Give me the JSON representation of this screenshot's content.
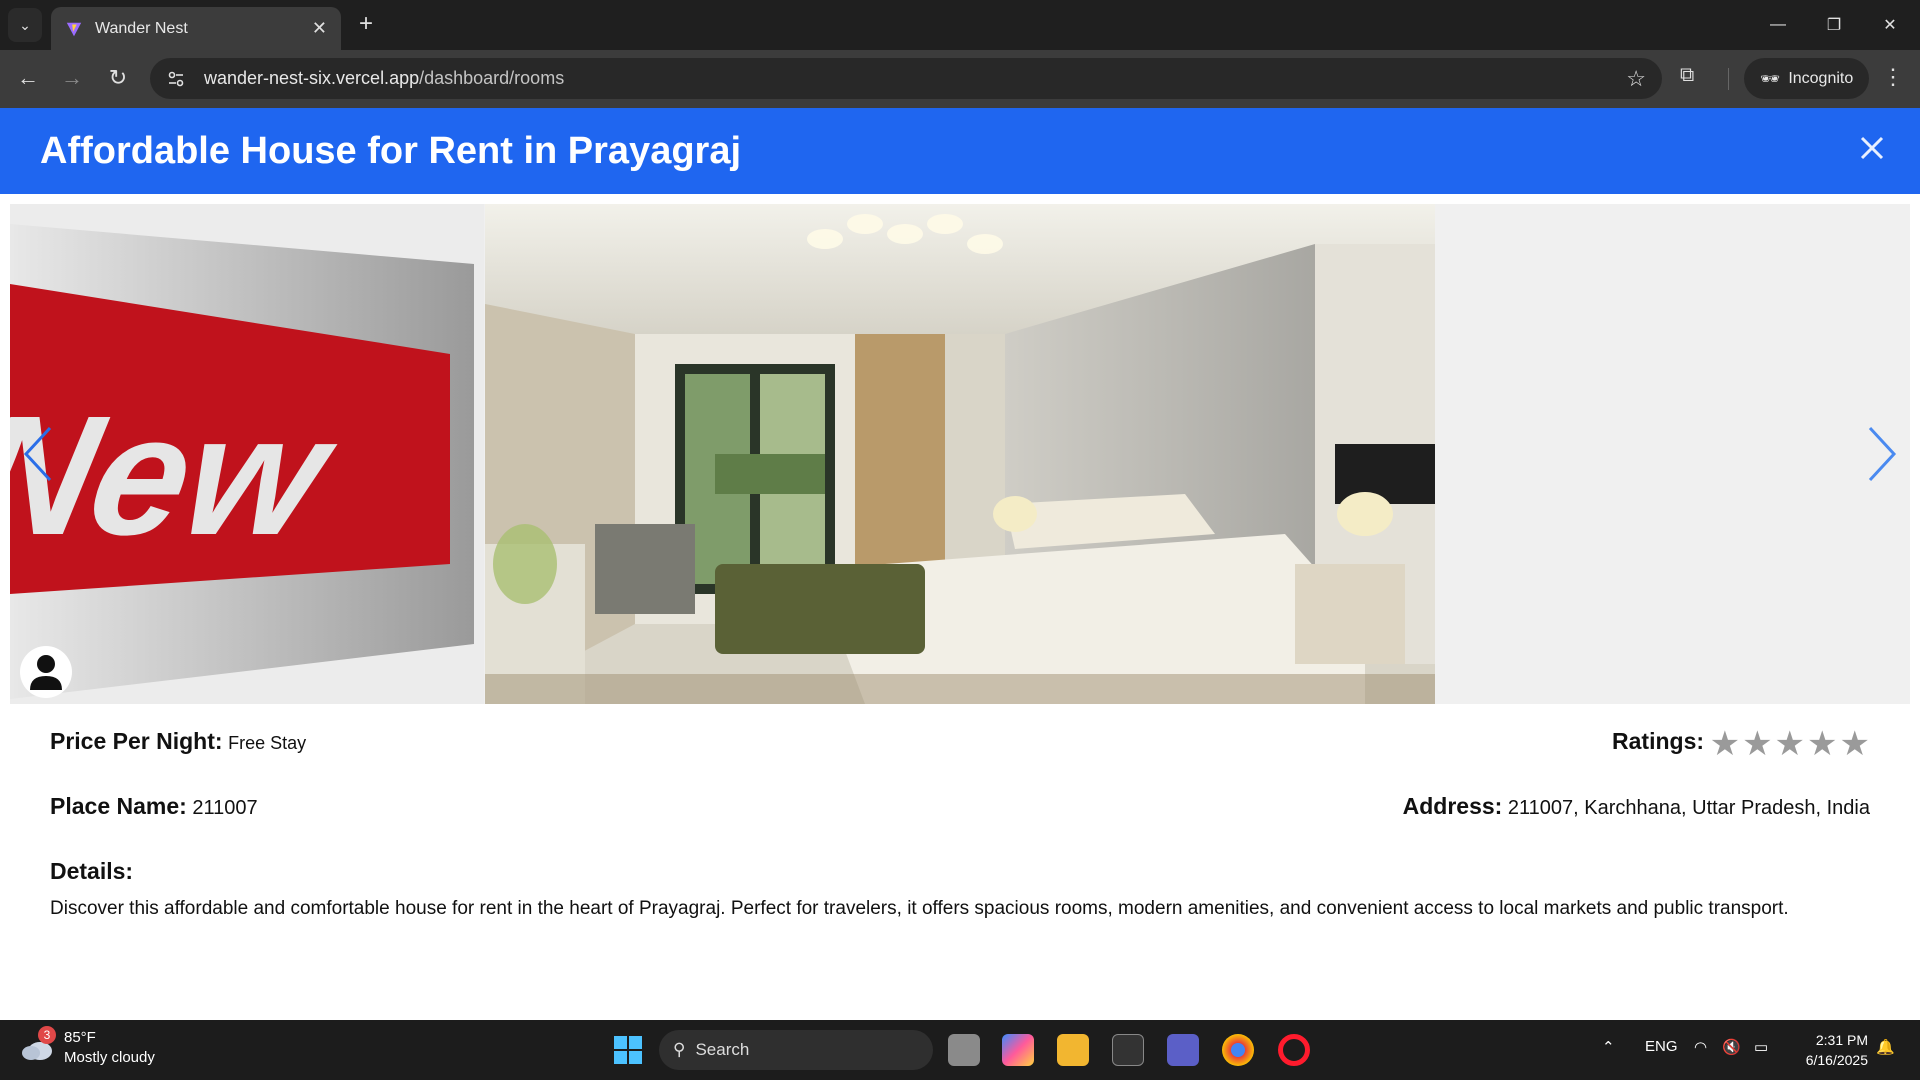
{
  "browser": {
    "tab_title": "Wander Nest",
    "url_domain": "wander-nest-six.vercel.app",
    "url_path": "/dashboard/rooms",
    "incognito_label": "Incognito"
  },
  "modal": {
    "title": "Affordable House for Rent in Prayagraj"
  },
  "carousel": {
    "left_slide_text": "New"
  },
  "details": {
    "price_label": "Price Per Night:",
    "price_value": "Free Stay",
    "ratings_label": "Ratings:",
    "rating_stars": 0,
    "rating_max": 5,
    "place_label": "Place Name:",
    "place_value": "211007",
    "address_label": "Address:",
    "address_value": "211007, Karchhana, Uttar Pradesh, India",
    "details_label": "Details:",
    "description": "Discover this affordable and comfortable house for rent in the heart of Prayagraj. Perfect for travelers, it offers spacious rooms, modern amenities, and convenient access to local markets and public transport."
  },
  "taskbar": {
    "weather_temp": "85°F",
    "weather_desc": "Mostly cloudy",
    "weather_badge": "3",
    "search_label": "Search",
    "lang": "ENG",
    "time": "2:31 PM",
    "date": "6/16/2025"
  },
  "colors": {
    "header_blue": "#1f66f0",
    "star_gray": "#9a9a9a",
    "arrow_blue": "#2a6ee8"
  }
}
